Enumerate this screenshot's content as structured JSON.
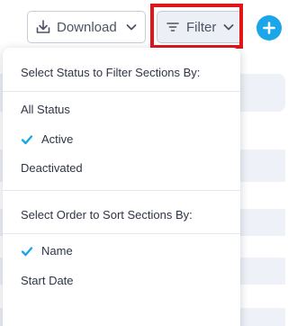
{
  "toolbar": {
    "download_label": "Download",
    "filter_label": "Filter"
  },
  "filter_menu": {
    "status_heading": "Select Status to Filter Sections By:",
    "status_options": [
      {
        "label": "All Status",
        "selected": false
      },
      {
        "label": "Active",
        "selected": true
      },
      {
        "label": "Deactivated",
        "selected": false
      }
    ],
    "sort_heading": "Select Order to Sort Sections By:",
    "sort_options": [
      {
        "label": "Name",
        "selected": true
      },
      {
        "label": "Start Date",
        "selected": false
      }
    ]
  },
  "colors": {
    "accent": "#1aa6e8",
    "highlight": "#e0161b",
    "text": "#2f3545"
  },
  "icons": {
    "download": "download-icon",
    "filter": "filter-icon",
    "chevron": "chevron-down-icon",
    "add": "plus-circle-icon",
    "check": "checkmark-icon"
  }
}
